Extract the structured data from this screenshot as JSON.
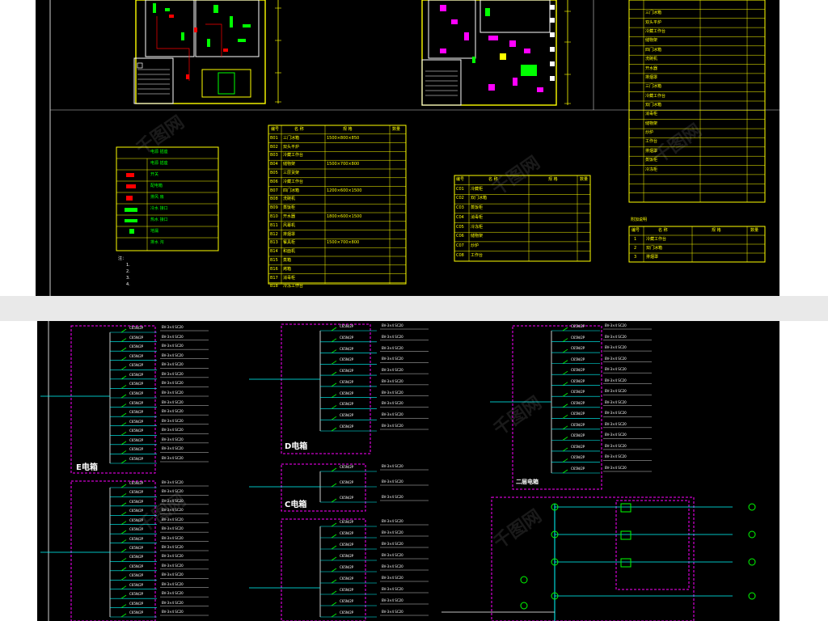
{
  "top_sheet": {
    "equipment_table_a": {
      "header": [
        "编号",
        "名 称",
        "规 格",
        "数量"
      ],
      "rows": [
        [
          "B01",
          "三门冰箱"
        ],
        [
          "B02",
          "双头平炉"
        ],
        [
          "B03",
          "冷藏工作台"
        ],
        [
          "B04",
          "储物架"
        ],
        [
          "B05",
          "三层货架"
        ],
        [
          "B06",
          "冷藏工作台"
        ],
        [
          "B07",
          "四门冰箱"
        ],
        [
          "B08",
          "洗碗机"
        ],
        [
          "B09",
          "蒸饭柜"
        ],
        [
          "B10",
          "开水器"
        ],
        [
          "B11",
          "风幕机"
        ],
        [
          "B12",
          "排烟罩"
        ],
        [
          "B13",
          "餐具柜"
        ],
        [
          "B14",
          "和面机"
        ],
        [
          "B15",
          "蒸箱"
        ],
        [
          "B16",
          "烤箱"
        ],
        [
          "B17",
          "消毒柜"
        ],
        [
          "B18",
          "冷冻工作台"
        ]
      ],
      "specs": [
        "1500×800×850",
        "1500×700×800",
        "1200×600×1500",
        "1800×600×1500",
        "1500×700×800"
      ]
    },
    "equipment_table_b": {
      "header": [
        "编号",
        "名 称",
        "规 格",
        "数量"
      ],
      "rows": [
        [
          "C01",
          "冷藏柜"
        ],
        [
          "C02",
          "双门冰箱"
        ],
        [
          "C03",
          "蒸饭柜"
        ],
        [
          "C04",
          "消毒柜"
        ],
        [
          "C05",
          "冷冻柜"
        ],
        [
          "C06",
          "储物架"
        ],
        [
          "C07",
          "炒炉"
        ],
        [
          "C08",
          "工作台"
        ]
      ]
    },
    "equipment_table_c": {
      "rows": [
        "三门冰箱",
        "双头平炉",
        "冷藏工作台",
        "储物架",
        "四门冰箱",
        "洗碗机",
        "开水器",
        "排烟罩",
        "三门冰箱",
        "冷藏工作台",
        "双门冰箱",
        "消毒柜",
        "储物架",
        "炒炉",
        "工作台",
        "排烟罩",
        "蒸饭柜",
        "冷冻柜"
      ]
    },
    "equipment_table_d": {
      "title": "附加说明",
      "header": [
        "编号",
        "名 称",
        "规 格",
        "数量"
      ],
      "rows": [
        [
          "1",
          "冷藏工作台"
        ],
        [
          "2",
          "双门冰箱"
        ],
        [
          "3",
          "排烟罩"
        ]
      ]
    },
    "legend": {
      "rows": [
        "电源 插座",
        "电源 插座",
        "开关",
        "配电箱",
        "排风 扇",
        "冷水 接口",
        "热水 接口",
        "地漏",
        "排水 沟"
      ]
    },
    "notes": [
      "注：",
      "1.",
      "2.",
      "3.",
      "4."
    ]
  },
  "bottom_sheet": {
    "panels": [
      {
        "name": "E电箱"
      },
      {
        "name": "D电箱"
      },
      {
        "name": "C电箱"
      },
      {
        "name": "二层电箱"
      }
    ],
    "circuit_label": "C65N/2P",
    "cable_label": "BV-3×4 SC20"
  },
  "watermark": "千图网",
  "colors": {
    "background": "#000000",
    "table": "#ffff00",
    "wall": "#ffffff",
    "equipment": "#ff00ff",
    "circuit": "#00ffff",
    "breaker": "#00ff00"
  }
}
